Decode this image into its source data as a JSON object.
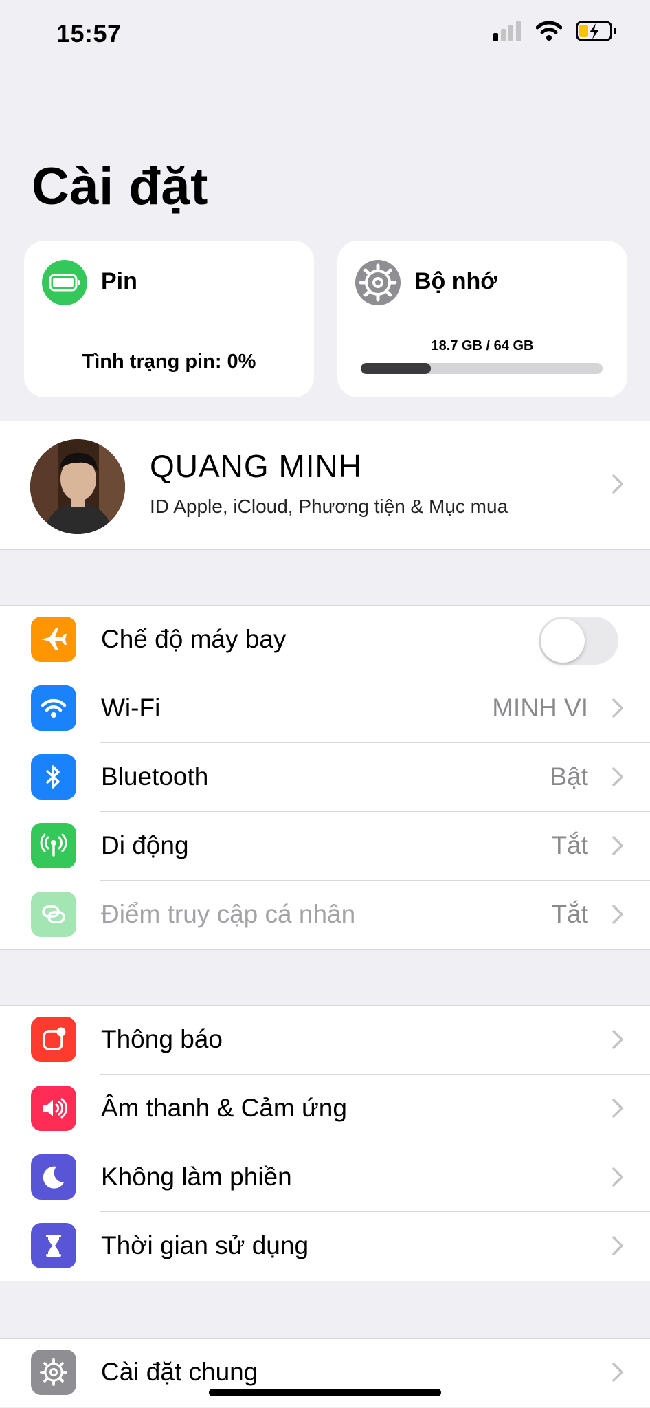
{
  "status_bar": {
    "time": "15:57"
  },
  "page_title": "Cài đặt",
  "cards": {
    "pin": {
      "title": "Pin",
      "status": "Tình trạng pin: 0%"
    },
    "memory": {
      "title": "Bộ nhớ",
      "usage": "18.7 GB / 64 GB",
      "used_fraction": 0.29
    }
  },
  "profile": {
    "name": "QUANG MINH",
    "subtitle": "ID Apple, iCloud, Phương tiện & Mục mua"
  },
  "groups": {
    "connectivity": [
      {
        "label": "Chế độ máy bay",
        "icon": "airplane-icon",
        "color": "#ff9500",
        "toggle": false
      },
      {
        "label": "Wi-Fi",
        "value": "MINH VI",
        "icon": "wifi-icon",
        "color": "#1a82fb"
      },
      {
        "label": "Bluetooth",
        "value": "Bật",
        "icon": "bluetooth-icon",
        "color": "#1a82fb"
      },
      {
        "label": "Di động",
        "value": "Tắt",
        "icon": "cellular-icon",
        "color": "#34c759"
      },
      {
        "label": "Điểm truy cập cá nhân",
        "value": "Tắt",
        "icon": "hotspot-icon",
        "color": "#34c759"
      }
    ],
    "notifications": [
      {
        "label": "Thông báo",
        "icon": "notifications-icon",
        "color": "#ff3b30"
      },
      {
        "label": "Âm thanh & Cảm ứng",
        "icon": "sound-icon",
        "color": "#ff2d55"
      },
      {
        "label": "Không làm phiền",
        "icon": "moon-icon",
        "color": "#5856d6"
      },
      {
        "label": "Thời gian sử dụng",
        "icon": "hourglass-icon",
        "color": "#5856d6"
      }
    ],
    "general": [
      {
        "label": "Cài đặt chung",
        "icon": "gear-icon",
        "color": "#8e8e93"
      }
    ]
  }
}
